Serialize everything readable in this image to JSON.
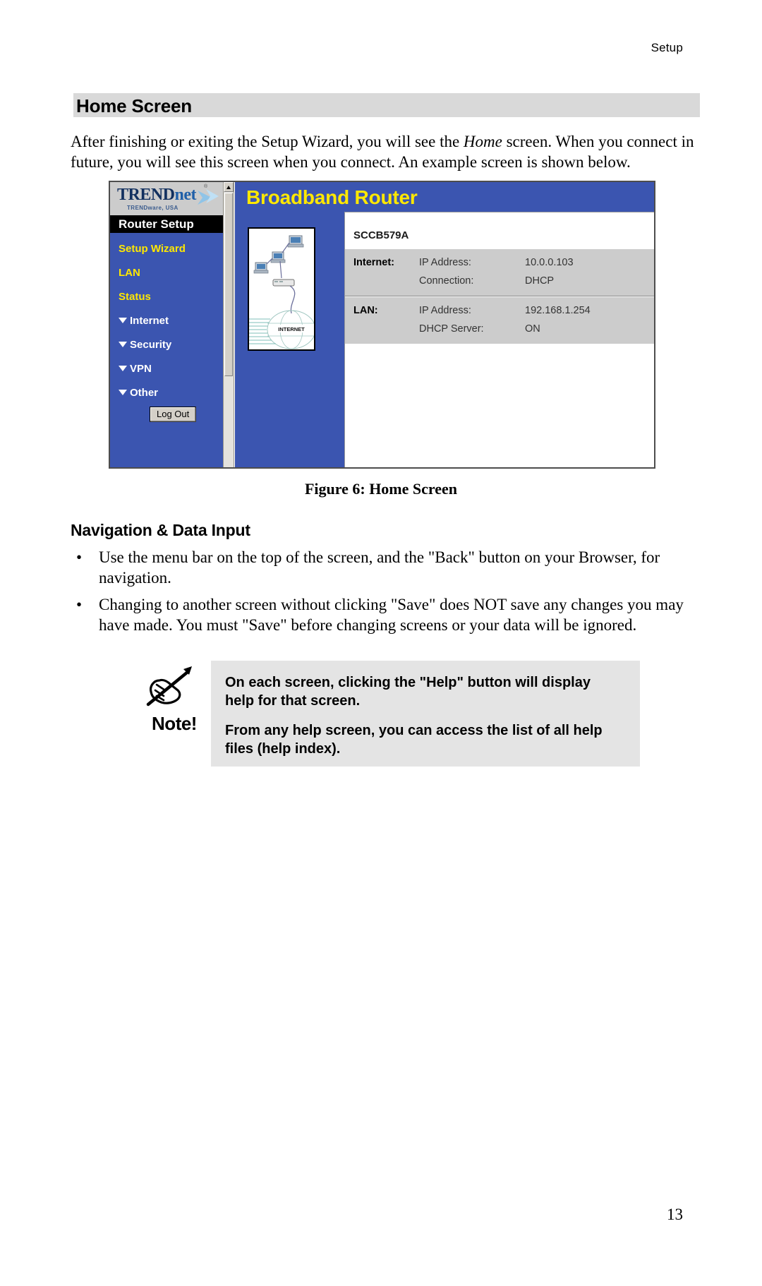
{
  "header": {
    "running_head": "Setup"
  },
  "section": {
    "title": "Home Screen",
    "intro_part1": "After finishing or exiting the Setup Wizard, you will see the ",
    "intro_emphasis": "Home",
    "intro_part2": " screen. When you connect in future, you will see this screen when you connect. An example screen is shown below."
  },
  "figure": {
    "caption": "Figure 6: Home Screen",
    "screenshot": {
      "brand": {
        "name_part1": "TREND",
        "name_part2": "net",
        "registered_mark": "®",
        "tagline": "TRENDware, USA",
        "swoosh_icon": "swoosh-icon"
      },
      "sidebar": {
        "section_title": "Router Setup",
        "items": [
          {
            "label": "Setup Wizard",
            "type": "link"
          },
          {
            "label": "LAN",
            "type": "link"
          },
          {
            "label": "Status",
            "type": "link"
          },
          {
            "label": "Internet",
            "type": "submenu"
          },
          {
            "label": "Security",
            "type": "submenu"
          },
          {
            "label": "VPN",
            "type": "submenu"
          },
          {
            "label": "Other",
            "type": "submenu"
          }
        ],
        "logout_label": "Log Out"
      },
      "banner_title": "Broadband Router",
      "network_diagram_label": "INTERNET",
      "device_name": "SCCB579A",
      "status": [
        {
          "group": "Internet:",
          "rows": [
            {
              "key": "IP Address:",
              "value": "10.0.0.103"
            },
            {
              "key": "Connection:",
              "value": "DHCP"
            }
          ]
        },
        {
          "group": "LAN:",
          "rows": [
            {
              "key": "IP Address:",
              "value": "192.168.1.254"
            },
            {
              "key": "DHCP Server:",
              "value": "ON"
            }
          ]
        }
      ]
    }
  },
  "navigation_section": {
    "title": "Navigation & Data Input",
    "bullets": [
      "Use the menu bar on the top of the screen, and the \"Back\" button on your Browser, for navigation.",
      "Changing to another screen without clicking \"Save\" does NOT save any changes you may have made. You must \"Save\" before changing screens or your data will be ignored."
    ]
  },
  "note": {
    "icon_label": "Note!",
    "icon_name": "hand-writing-icon",
    "paragraphs": [
      "On each screen, clicking the \"Help\" button will display help for that screen.",
      "From any help screen, you can access the list of all help files (help index)."
    ]
  },
  "footer": {
    "page_number": "13"
  }
}
